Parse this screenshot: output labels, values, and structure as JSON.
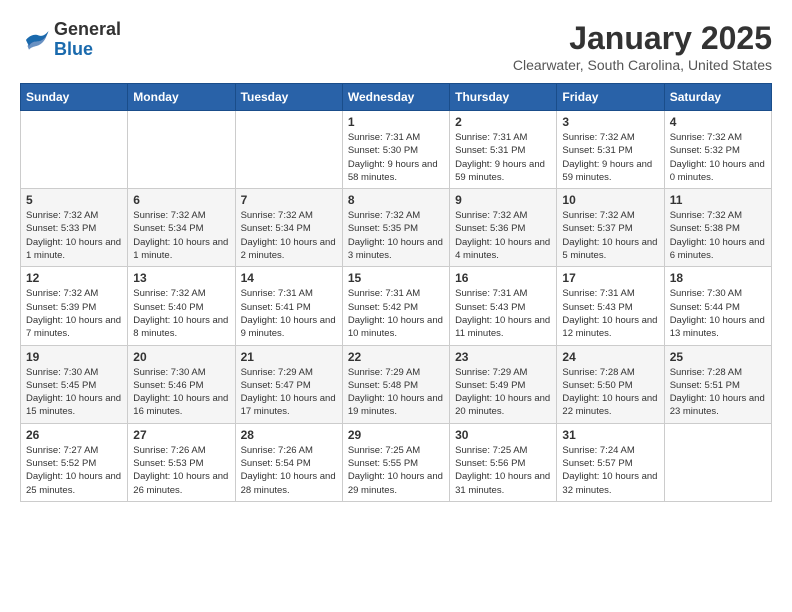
{
  "header": {
    "logo": {
      "general": "General",
      "blue": "Blue"
    },
    "title": "January 2025",
    "location": "Clearwater, South Carolina, United States"
  },
  "calendar": {
    "days_of_week": [
      "Sunday",
      "Monday",
      "Tuesday",
      "Wednesday",
      "Thursday",
      "Friday",
      "Saturday"
    ],
    "weeks": [
      [
        {
          "day": "",
          "info": ""
        },
        {
          "day": "",
          "info": ""
        },
        {
          "day": "",
          "info": ""
        },
        {
          "day": "1",
          "info": "Sunrise: 7:31 AM\nSunset: 5:30 PM\nDaylight: 9 hours and 58 minutes."
        },
        {
          "day": "2",
          "info": "Sunrise: 7:31 AM\nSunset: 5:31 PM\nDaylight: 9 hours and 59 minutes."
        },
        {
          "day": "3",
          "info": "Sunrise: 7:32 AM\nSunset: 5:31 PM\nDaylight: 9 hours and 59 minutes."
        },
        {
          "day": "4",
          "info": "Sunrise: 7:32 AM\nSunset: 5:32 PM\nDaylight: 10 hours and 0 minutes."
        }
      ],
      [
        {
          "day": "5",
          "info": "Sunrise: 7:32 AM\nSunset: 5:33 PM\nDaylight: 10 hours and 1 minute."
        },
        {
          "day": "6",
          "info": "Sunrise: 7:32 AM\nSunset: 5:34 PM\nDaylight: 10 hours and 1 minute."
        },
        {
          "day": "7",
          "info": "Sunrise: 7:32 AM\nSunset: 5:34 PM\nDaylight: 10 hours and 2 minutes."
        },
        {
          "day": "8",
          "info": "Sunrise: 7:32 AM\nSunset: 5:35 PM\nDaylight: 10 hours and 3 minutes."
        },
        {
          "day": "9",
          "info": "Sunrise: 7:32 AM\nSunset: 5:36 PM\nDaylight: 10 hours and 4 minutes."
        },
        {
          "day": "10",
          "info": "Sunrise: 7:32 AM\nSunset: 5:37 PM\nDaylight: 10 hours and 5 minutes."
        },
        {
          "day": "11",
          "info": "Sunrise: 7:32 AM\nSunset: 5:38 PM\nDaylight: 10 hours and 6 minutes."
        }
      ],
      [
        {
          "day": "12",
          "info": "Sunrise: 7:32 AM\nSunset: 5:39 PM\nDaylight: 10 hours and 7 minutes."
        },
        {
          "day": "13",
          "info": "Sunrise: 7:32 AM\nSunset: 5:40 PM\nDaylight: 10 hours and 8 minutes."
        },
        {
          "day": "14",
          "info": "Sunrise: 7:31 AM\nSunset: 5:41 PM\nDaylight: 10 hours and 9 minutes."
        },
        {
          "day": "15",
          "info": "Sunrise: 7:31 AM\nSunset: 5:42 PM\nDaylight: 10 hours and 10 minutes."
        },
        {
          "day": "16",
          "info": "Sunrise: 7:31 AM\nSunset: 5:43 PM\nDaylight: 10 hours and 11 minutes."
        },
        {
          "day": "17",
          "info": "Sunrise: 7:31 AM\nSunset: 5:43 PM\nDaylight: 10 hours and 12 minutes."
        },
        {
          "day": "18",
          "info": "Sunrise: 7:30 AM\nSunset: 5:44 PM\nDaylight: 10 hours and 13 minutes."
        }
      ],
      [
        {
          "day": "19",
          "info": "Sunrise: 7:30 AM\nSunset: 5:45 PM\nDaylight: 10 hours and 15 minutes."
        },
        {
          "day": "20",
          "info": "Sunrise: 7:30 AM\nSunset: 5:46 PM\nDaylight: 10 hours and 16 minutes."
        },
        {
          "day": "21",
          "info": "Sunrise: 7:29 AM\nSunset: 5:47 PM\nDaylight: 10 hours and 17 minutes."
        },
        {
          "day": "22",
          "info": "Sunrise: 7:29 AM\nSunset: 5:48 PM\nDaylight: 10 hours and 19 minutes."
        },
        {
          "day": "23",
          "info": "Sunrise: 7:29 AM\nSunset: 5:49 PM\nDaylight: 10 hours and 20 minutes."
        },
        {
          "day": "24",
          "info": "Sunrise: 7:28 AM\nSunset: 5:50 PM\nDaylight: 10 hours and 22 minutes."
        },
        {
          "day": "25",
          "info": "Sunrise: 7:28 AM\nSunset: 5:51 PM\nDaylight: 10 hours and 23 minutes."
        }
      ],
      [
        {
          "day": "26",
          "info": "Sunrise: 7:27 AM\nSunset: 5:52 PM\nDaylight: 10 hours and 25 minutes."
        },
        {
          "day": "27",
          "info": "Sunrise: 7:26 AM\nSunset: 5:53 PM\nDaylight: 10 hours and 26 minutes."
        },
        {
          "day": "28",
          "info": "Sunrise: 7:26 AM\nSunset: 5:54 PM\nDaylight: 10 hours and 28 minutes."
        },
        {
          "day": "29",
          "info": "Sunrise: 7:25 AM\nSunset: 5:55 PM\nDaylight: 10 hours and 29 minutes."
        },
        {
          "day": "30",
          "info": "Sunrise: 7:25 AM\nSunset: 5:56 PM\nDaylight: 10 hours and 31 minutes."
        },
        {
          "day": "31",
          "info": "Sunrise: 7:24 AM\nSunset: 5:57 PM\nDaylight: 10 hours and 32 minutes."
        },
        {
          "day": "",
          "info": ""
        }
      ]
    ]
  }
}
